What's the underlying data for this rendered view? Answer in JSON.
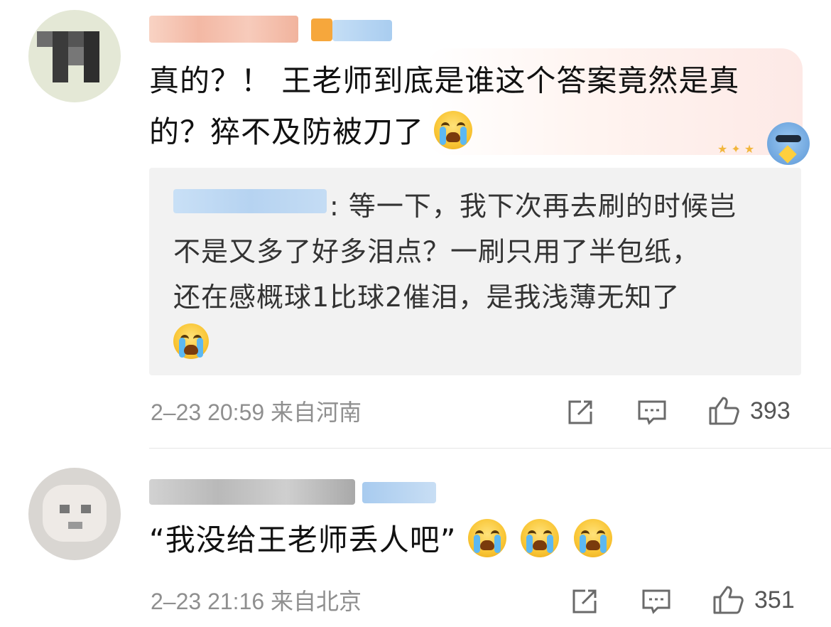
{
  "comments": [
    {
      "text_line1": "真的？！ 王老师到底是谁这个答案竟然是真",
      "text_line2": "的？猝不及防被刀了",
      "emoji": "crying-face",
      "reply": {
        "line1": ": 等一下，我下次再去刷的时候岂",
        "line2": "不是又多了好多泪点？一刷只用了半包纸，",
        "line3": "还在感概球1比球2催泪，是我浅薄无知了",
        "emoji": "loudly-crying-face"
      },
      "meta": "2–23 20:59 来自河南",
      "likes": "393"
    },
    {
      "text": "“我没给王老师丢人吧”",
      "emojis": [
        "crying-face",
        "crying-face",
        "crying-face"
      ],
      "meta": "2–23 21:16 来自北京",
      "likes": "351"
    }
  ],
  "colors": {
    "meta_text": "#8f8f8f",
    "quote_bg": "#f2f2f2",
    "blurred_name": "#f4c7b8",
    "blurred_badge": "#bcd7f2"
  },
  "icons": [
    "share-icon",
    "comment-icon",
    "thumbs-up-icon"
  ]
}
